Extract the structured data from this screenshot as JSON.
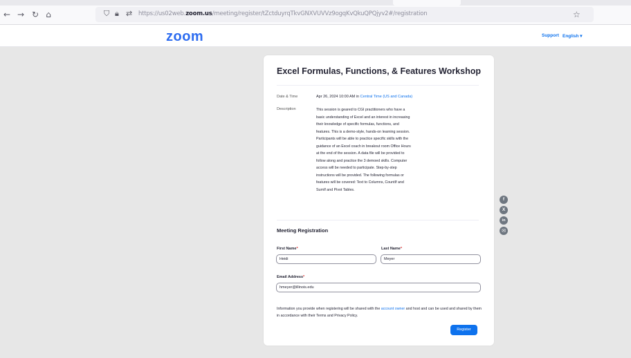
{
  "browser": {
    "url_prefix": "https://us02web.",
    "url_domain": "zoom.us",
    "url_path": "/meeting/register/tZctduyrqTkvGNXVUVVz9ogqKvQkuQPQjyv2#/registration",
    "icons": [
      "back-arrow-icon",
      "forward-arrow-icon",
      "reload-icon",
      "home-icon",
      "shield-icon",
      "lock-icon",
      "permissions-icon",
      "bookmark-star-icon"
    ]
  },
  "header": {
    "logo": "zoom",
    "support": "Support",
    "language": "English ▾"
  },
  "meeting": {
    "title": "Excel Formulas, Functions, & Features Workshop",
    "date_label": "Date & Time",
    "date_value": "Apr 26, 2024 10:00 AM  in ",
    "timezone": "Central Time (US and Canada)",
    "desc_label": "Description",
    "description_lines": [
      "This session is geared to CGI practitioners who have a",
      "basic understanding of Excel and an interest in increasing",
      "their knowledge of specific formulas, functions, and",
      "features. This is a demo-style, hands-on learning session.",
      "Participants will be able to practice specific skills with the",
      "guidance of an Excel coach in breakout room Office Hours",
      "at the end of the session.  A data file will be provided to",
      "follow along and practice the 3 demoed skills.  Computer",
      "access will be needed to participate. Step-by-step",
      "instructions will be provided. The following formulas or",
      "features will be covered: Text to Columns, CountIf and",
      "SumIf and Pivot Tables."
    ]
  },
  "registration": {
    "section_title": "Meeting Registration",
    "first_name_label": "First Name",
    "first_name_value": "Heidi",
    "last_name_label": "Last Name",
    "last_name_value": "Meyer",
    "email_label": "Email Address",
    "email_value": "hmeyer@illinois.edu",
    "required_mark": "*",
    "info_before": "Information you provide when registering will be shared with the ",
    "info_link": "account owner",
    "info_after": " and host and can be used and shared by them in accordance with their Terms and Privacy Policy.",
    "register_button": "Register"
  },
  "share": {
    "icons": [
      "facebook-icon",
      "x-twitter-icon",
      "linkedin-icon",
      "email-icon"
    ],
    "glyphs": [
      "f",
      "X",
      "in",
      "✉"
    ]
  },
  "colors": {
    "zoom_blue": "#0e72ed",
    "page_bg": "#e7e7e7"
  }
}
